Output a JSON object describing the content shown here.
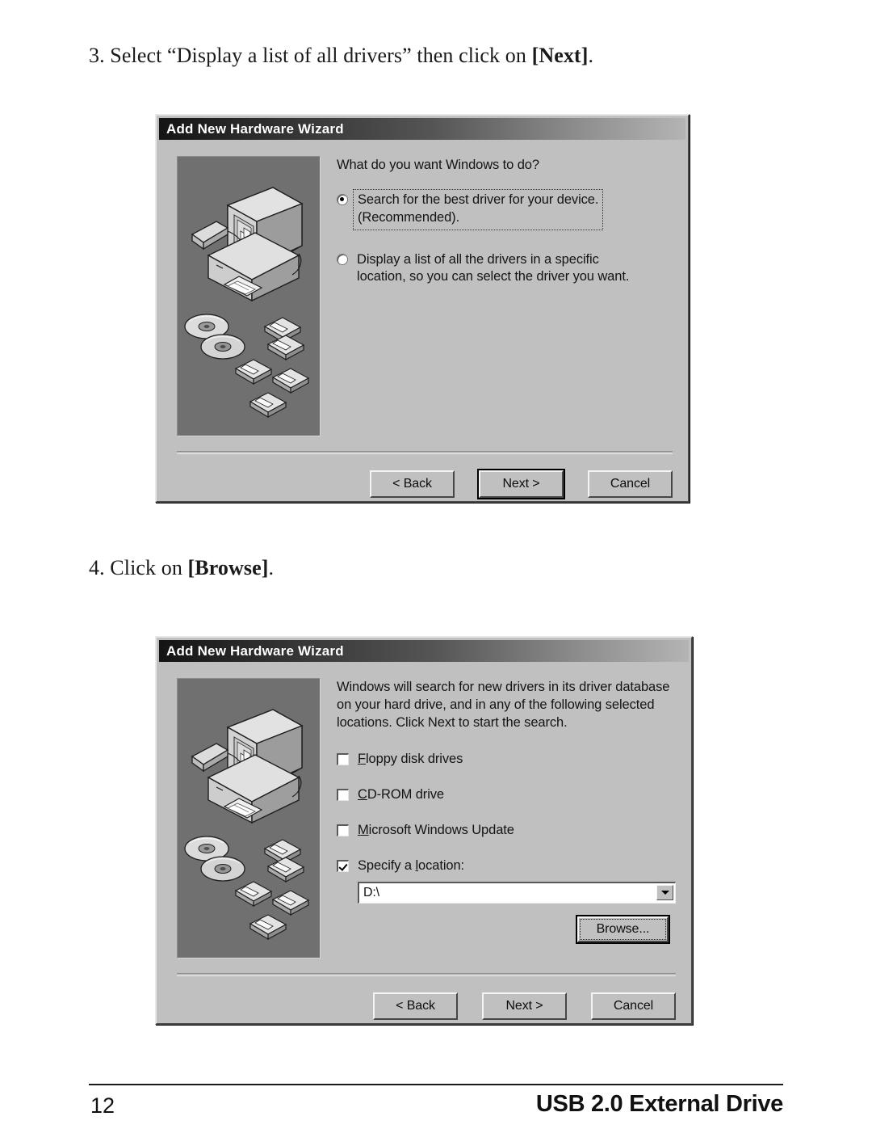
{
  "instructions": [
    {
      "number": "3.",
      "text_before": " Select “Display a list of all drivers” then click on ",
      "bold": "[Next]",
      "text_after": "."
    },
    {
      "number": "4.",
      "text_before": " Click on ",
      "bold": "[Browse]",
      "text_after": "."
    }
  ],
  "dialog1": {
    "title": "Add New Hardware Wizard",
    "prompt": "What do you want Windows to do?",
    "options": [
      {
        "line1": "Search for the best driver for your device.",
        "line2": "(Recommended).",
        "selected": true,
        "focused": true
      },
      {
        "line1": "Display a list of all the drivers in a specific",
        "line2": "location, so you can select the driver you want.",
        "selected": false,
        "focused": false
      }
    ],
    "buttons": {
      "back": "< Back",
      "next": "Next >",
      "cancel": "Cancel"
    }
  },
  "dialog2": {
    "title": "Add New Hardware Wizard",
    "prompt_line1": "Windows will search for new drivers in its driver database",
    "prompt_line2": "on your hard drive, and in any of the following selected",
    "prompt_line3": "locations. Click Next to start the search.",
    "checkboxes": [
      {
        "accel": "F",
        "rest": "loppy disk drives",
        "checked": false
      },
      {
        "accel": "C",
        "rest": "D-ROM drive",
        "checked": false
      },
      {
        "accel": "M",
        "rest": "icrosoft Windows Update",
        "checked": false
      }
    ],
    "specify_location": {
      "prefix": "Specify a ",
      "accel": "l",
      "rest": "ocation:",
      "checked": true
    },
    "location_value": "D:\\",
    "browse_button": "Browse...",
    "buttons": {
      "back": "< Back",
      "next": "Next >",
      "cancel": "Cancel"
    }
  },
  "footer": {
    "page_number": "12",
    "title": "USB 2.0 External Drive"
  },
  "colors": {
    "dialog_face": "#c0c0c0",
    "illustration_panel": "#707070",
    "titlebar_dark": "#141414",
    "text": "#141414",
    "page_background": "#ffffff"
  }
}
